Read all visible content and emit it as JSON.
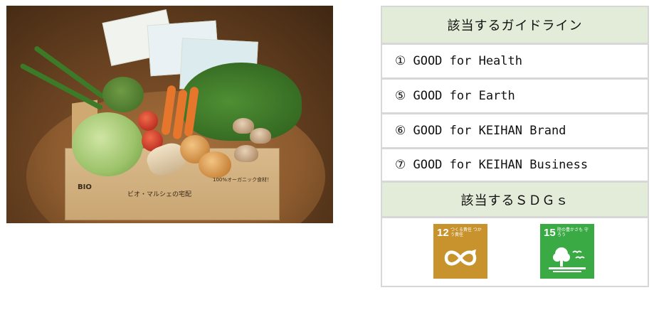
{
  "photo": {
    "alt": "Organic vegetable delivery box",
    "box_logo": "BIO",
    "box_text": "ビオ・マルシェの宅配",
    "box_subtext": "100%オーガニック食材！"
  },
  "guidelines": {
    "header": "該当するガイドライン",
    "items": [
      "① GOOD for Health",
      "⑤ GOOD for Earth",
      "⑥ GOOD for KEIHAN Brand",
      "⑦ GOOD for KEIHAN Business"
    ]
  },
  "sdgs": {
    "header": "該当するＳＤＧｓ",
    "goals": [
      {
        "number": "12",
        "caption": "つくる責任 つかう責任",
        "color": "#c8922d",
        "icon": "infinity-icon"
      },
      {
        "number": "15",
        "caption": "陸の豊かさも 守ろう",
        "color": "#3aab44",
        "icon": "tree-icon"
      }
    ]
  }
}
